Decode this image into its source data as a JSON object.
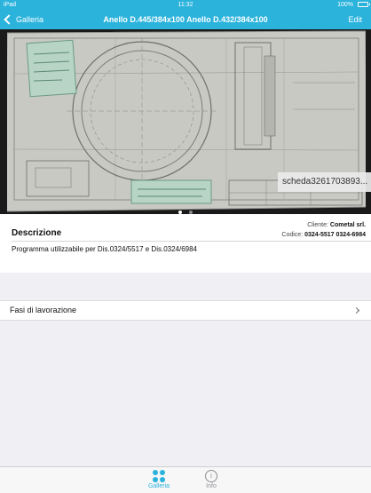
{
  "status_bar": {
    "carrier": "iPad",
    "time": "11:32",
    "battery_percent": "100%"
  },
  "nav_bar": {
    "back_label": "Galleria",
    "title": "Anello D.445/384x100 Anello D.432/384x100",
    "edit_label": "Edit"
  },
  "gallery": {
    "photo_caption": "scheda3261703893...",
    "page_count": 2,
    "current_page": 1
  },
  "info": {
    "client_label": "Cliente:",
    "client_value": "Cometal srl.",
    "code_label": "Codice:",
    "code_value": "0324-5517 0324-6984",
    "description_heading": "Descrizione",
    "description_text": "Programma utilizzabile per Dis.0324/5517 e Dis.0324/6984"
  },
  "phases": {
    "label": "Fasi di lavorazione"
  },
  "tab_bar": {
    "tabs": [
      {
        "label": "Galleria",
        "icon": "grid-icon",
        "active": true
      },
      {
        "label": "Info",
        "icon": "info-icon",
        "active": false
      }
    ]
  },
  "colors": {
    "accent": "#2bb3dc",
    "background": "#efeff4"
  }
}
